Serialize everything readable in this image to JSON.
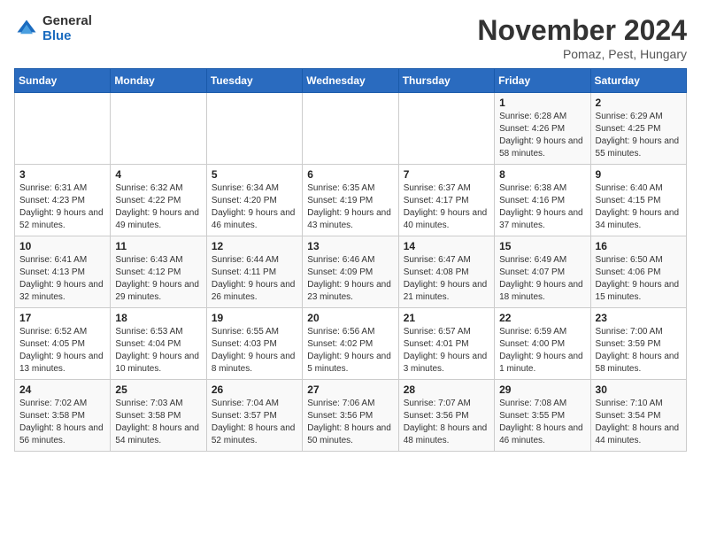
{
  "header": {
    "logo_general": "General",
    "logo_blue": "Blue",
    "month_title": "November 2024",
    "subtitle": "Pomaz, Pest, Hungary"
  },
  "days_of_week": [
    "Sunday",
    "Monday",
    "Tuesday",
    "Wednesday",
    "Thursday",
    "Friday",
    "Saturday"
  ],
  "weeks": [
    [
      {
        "day": "",
        "info": ""
      },
      {
        "day": "",
        "info": ""
      },
      {
        "day": "",
        "info": ""
      },
      {
        "day": "",
        "info": ""
      },
      {
        "day": "",
        "info": ""
      },
      {
        "day": "1",
        "info": "Sunrise: 6:28 AM\nSunset: 4:26 PM\nDaylight: 9 hours and 58 minutes."
      },
      {
        "day": "2",
        "info": "Sunrise: 6:29 AM\nSunset: 4:25 PM\nDaylight: 9 hours and 55 minutes."
      }
    ],
    [
      {
        "day": "3",
        "info": "Sunrise: 6:31 AM\nSunset: 4:23 PM\nDaylight: 9 hours and 52 minutes."
      },
      {
        "day": "4",
        "info": "Sunrise: 6:32 AM\nSunset: 4:22 PM\nDaylight: 9 hours and 49 minutes."
      },
      {
        "day": "5",
        "info": "Sunrise: 6:34 AM\nSunset: 4:20 PM\nDaylight: 9 hours and 46 minutes."
      },
      {
        "day": "6",
        "info": "Sunrise: 6:35 AM\nSunset: 4:19 PM\nDaylight: 9 hours and 43 minutes."
      },
      {
        "day": "7",
        "info": "Sunrise: 6:37 AM\nSunset: 4:17 PM\nDaylight: 9 hours and 40 minutes."
      },
      {
        "day": "8",
        "info": "Sunrise: 6:38 AM\nSunset: 4:16 PM\nDaylight: 9 hours and 37 minutes."
      },
      {
        "day": "9",
        "info": "Sunrise: 6:40 AM\nSunset: 4:15 PM\nDaylight: 9 hours and 34 minutes."
      }
    ],
    [
      {
        "day": "10",
        "info": "Sunrise: 6:41 AM\nSunset: 4:13 PM\nDaylight: 9 hours and 32 minutes."
      },
      {
        "day": "11",
        "info": "Sunrise: 6:43 AM\nSunset: 4:12 PM\nDaylight: 9 hours and 29 minutes."
      },
      {
        "day": "12",
        "info": "Sunrise: 6:44 AM\nSunset: 4:11 PM\nDaylight: 9 hours and 26 minutes."
      },
      {
        "day": "13",
        "info": "Sunrise: 6:46 AM\nSunset: 4:09 PM\nDaylight: 9 hours and 23 minutes."
      },
      {
        "day": "14",
        "info": "Sunrise: 6:47 AM\nSunset: 4:08 PM\nDaylight: 9 hours and 21 minutes."
      },
      {
        "day": "15",
        "info": "Sunrise: 6:49 AM\nSunset: 4:07 PM\nDaylight: 9 hours and 18 minutes."
      },
      {
        "day": "16",
        "info": "Sunrise: 6:50 AM\nSunset: 4:06 PM\nDaylight: 9 hours and 15 minutes."
      }
    ],
    [
      {
        "day": "17",
        "info": "Sunrise: 6:52 AM\nSunset: 4:05 PM\nDaylight: 9 hours and 13 minutes."
      },
      {
        "day": "18",
        "info": "Sunrise: 6:53 AM\nSunset: 4:04 PM\nDaylight: 9 hours and 10 minutes."
      },
      {
        "day": "19",
        "info": "Sunrise: 6:55 AM\nSunset: 4:03 PM\nDaylight: 9 hours and 8 minutes."
      },
      {
        "day": "20",
        "info": "Sunrise: 6:56 AM\nSunset: 4:02 PM\nDaylight: 9 hours and 5 minutes."
      },
      {
        "day": "21",
        "info": "Sunrise: 6:57 AM\nSunset: 4:01 PM\nDaylight: 9 hours and 3 minutes."
      },
      {
        "day": "22",
        "info": "Sunrise: 6:59 AM\nSunset: 4:00 PM\nDaylight: 9 hours and 1 minute."
      },
      {
        "day": "23",
        "info": "Sunrise: 7:00 AM\nSunset: 3:59 PM\nDaylight: 8 hours and 58 minutes."
      }
    ],
    [
      {
        "day": "24",
        "info": "Sunrise: 7:02 AM\nSunset: 3:58 PM\nDaylight: 8 hours and 56 minutes."
      },
      {
        "day": "25",
        "info": "Sunrise: 7:03 AM\nSunset: 3:58 PM\nDaylight: 8 hours and 54 minutes."
      },
      {
        "day": "26",
        "info": "Sunrise: 7:04 AM\nSunset: 3:57 PM\nDaylight: 8 hours and 52 minutes."
      },
      {
        "day": "27",
        "info": "Sunrise: 7:06 AM\nSunset: 3:56 PM\nDaylight: 8 hours and 50 minutes."
      },
      {
        "day": "28",
        "info": "Sunrise: 7:07 AM\nSunset: 3:56 PM\nDaylight: 8 hours and 48 minutes."
      },
      {
        "day": "29",
        "info": "Sunrise: 7:08 AM\nSunset: 3:55 PM\nDaylight: 8 hours and 46 minutes."
      },
      {
        "day": "30",
        "info": "Sunrise: 7:10 AM\nSunset: 3:54 PM\nDaylight: 8 hours and 44 minutes."
      }
    ]
  ]
}
